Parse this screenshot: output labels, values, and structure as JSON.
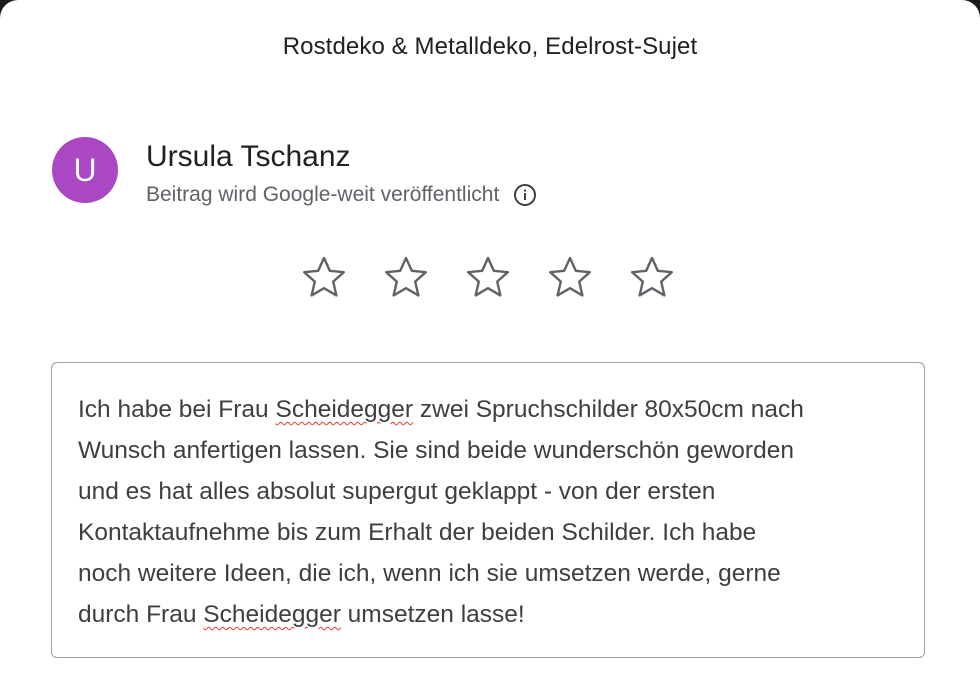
{
  "dialog": {
    "title": "Rostdeko & Metalldeko, Edelrost-Sujet"
  },
  "user": {
    "avatar_initial": "U",
    "avatar_color": "#a948c2",
    "name": "Ursula Tschanz",
    "post_info": "Beitrag wird Google-weit veröffentlicht",
    "info_icon": "info-icon"
  },
  "rating": {
    "max": 5,
    "selected": 0,
    "star_icon": "star-outline-icon"
  },
  "review": {
    "text_parts": [
      "Ich habe bei Frau ",
      "Scheidegger",
      " zwei Spruchschilder 80x50cm nach\nWunsch anfertigen lassen. Sie sind beide wunderschön geworden\nund es hat alles absolut supergut geklappt - von der ersten\nKontaktaufnehme bis zum Erhalt der beiden Schilder. Ich habe\nnoch weitere Ideen, die ich, wenn ich sie umsetzen werde, gerne\ndurch Frau ",
      "Scheidegger",
      " umsetzen lasse!"
    ]
  }
}
